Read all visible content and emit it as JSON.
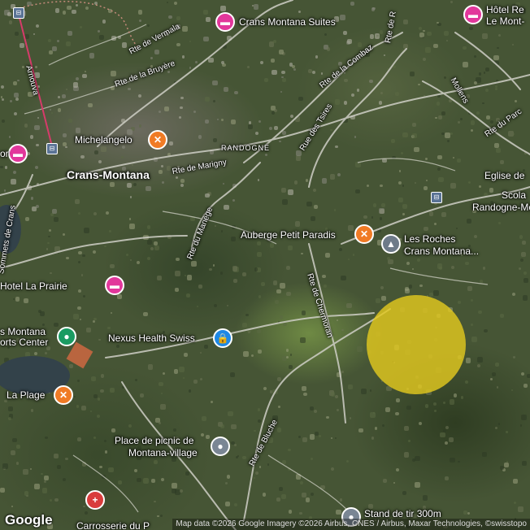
{
  "map": {
    "logo": "Google",
    "attribution": "Map data ©2026 Google Imagery ©2026 Airbus, CNES / Airbus, Maxar Technologies, ©swisstopo",
    "highlight_color": "#e2c81e"
  },
  "places": {
    "crans_montana_suites": "Crans Montana Suites",
    "hotel_re": "Hôtel Re",
    "le_mont": "Le Mont-",
    "michelangelo": "Michelangelo",
    "crans_montana": "Crans-Montana",
    "randogne_caps": "RANDOGNE",
    "eglise_de": "Eglise de",
    "scola": "Scola",
    "randogne_molle": "Randogne-Molle",
    "auberge": "Auberge Petit Paradis",
    "les_roches_1": "Les Roches",
    "les_roches_2": "Crans Montana...",
    "hotel_la_prairie": "Hotel La Prairie",
    "sports_1": "s Montana",
    "sports_2": "orts Center",
    "nexus": "Nexus Health Swiss",
    "la_plage": "La Plage",
    "picnic_1": "Place de picnic de",
    "picnic_2": "Montana-village",
    "stand": "Stand de tir 300m",
    "carrosserie": "Carrosserie du P",
    "or_fragment": "or"
  },
  "roads": {
    "vermala": "Rte de Vermala",
    "bruyere": "Rte de la Bruyère",
    "combaz": "Rte de la Combaz",
    "tsires": "Rue des Tsires",
    "marigny": "Rte de Marigny",
    "manege": "Rte du Manège",
    "chermoran": "Rte de Chermoran",
    "bluche": "Rte de Bluche",
    "arnouva": "Arnouva",
    "parc": "Rte du Parc",
    "mollens": "Mollens",
    "rte_de_r": "Rte de R",
    "sommets": "Sommets de Crans"
  },
  "icons": {
    "hotel": "bed-icon",
    "food": "fork-knife-icon",
    "sport": "sport-center-icon",
    "school": "graduation-cap-icon",
    "health": "lock-icon",
    "place": "location-dot-icon",
    "hospital": "hospital-icon",
    "bus": "bus-stop-icon"
  }
}
